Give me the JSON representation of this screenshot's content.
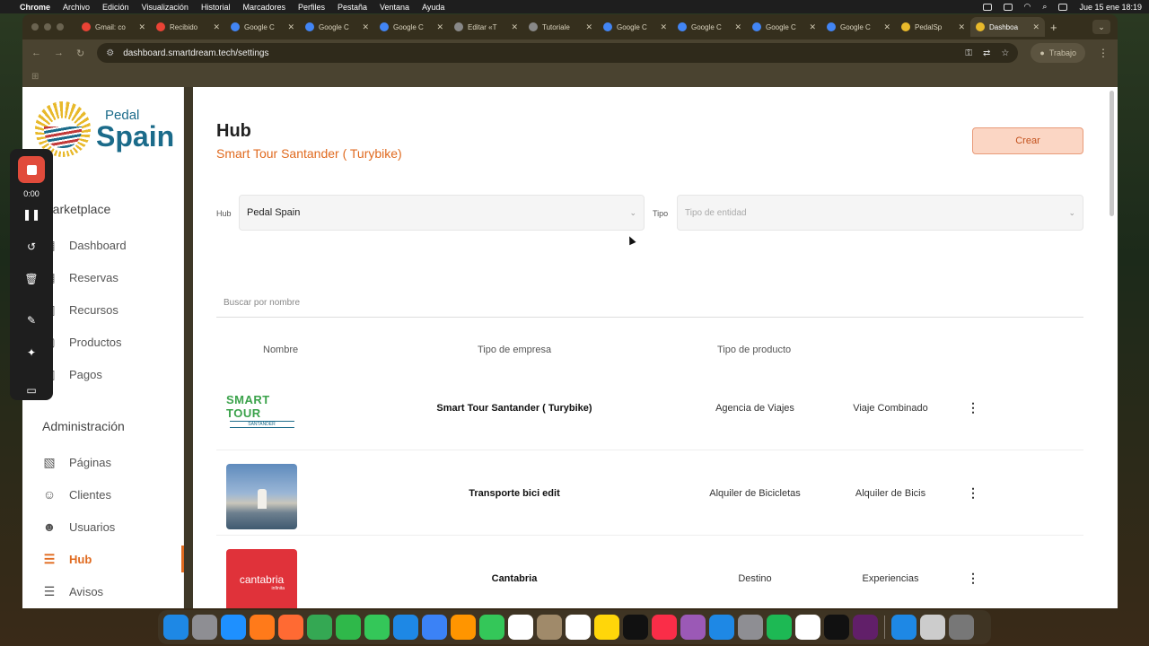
{
  "menubar": {
    "app": "Chrome",
    "items": [
      "Archivo",
      "Edición",
      "Visualización",
      "Historial",
      "Marcadores",
      "Perfiles",
      "Pestaña",
      "Ventana",
      "Ayuda"
    ],
    "clock": "Jue 15 ene 18:19"
  },
  "tabs": [
    {
      "label": "Gmail: co",
      "color": "#ea4335"
    },
    {
      "label": "Recibido",
      "color": "#ea4335"
    },
    {
      "label": "Google C",
      "color": "#4285f4"
    },
    {
      "label": "Google C",
      "color": "#4285f4"
    },
    {
      "label": "Google C",
      "color": "#4285f4"
    },
    {
      "label": "Editar «T",
      "color": "#888888"
    },
    {
      "label": "Tutoriale",
      "color": "#888888"
    },
    {
      "label": "Google C",
      "color": "#4285f4"
    },
    {
      "label": "Google C",
      "color": "#4285f4"
    },
    {
      "label": "Google C",
      "color": "#4285f4"
    },
    {
      "label": "Google C",
      "color": "#4285f4"
    },
    {
      "label": "PedalSp",
      "color": "#e8b92b"
    },
    {
      "label": "Dashboa",
      "color": "#e8b92b",
      "active": true
    }
  ],
  "toolbar": {
    "url": "dashboard.smartdream.tech/settings",
    "profile": "Trabajo"
  },
  "logo": {
    "line1": "Pedal",
    "line2": "Spain"
  },
  "recorder": {
    "time": "0:00"
  },
  "sidebar": {
    "marketplace_title": "Marketplace",
    "marketplace_items": [
      {
        "label": "Dashboard",
        "icon": "dashboard-icon"
      },
      {
        "label": "Reservas",
        "icon": "calendar-icon"
      },
      {
        "label": "Recursos",
        "icon": "resources-icon"
      },
      {
        "label": "Productos",
        "icon": "box-icon"
      },
      {
        "label": "Pagos",
        "icon": "payment-icon"
      }
    ],
    "admin_title": "Administración",
    "admin_items": [
      {
        "label": "Páginas",
        "icon": "page-icon"
      },
      {
        "label": "Clientes",
        "icon": "user-icon"
      },
      {
        "label": "Usuarios",
        "icon": "users-icon"
      },
      {
        "label": "Hub",
        "icon": "sliders-icon",
        "active": true
      },
      {
        "label": "Avisos",
        "icon": "sliders-icon"
      }
    ]
  },
  "main": {
    "title": "Hub",
    "subtitle": "Smart Tour Santander ( Turybike)",
    "create_label": "Crear",
    "hub_label": "Hub",
    "hub_value": "Pedal Spain",
    "tipo_label": "Tipo",
    "tipo_placeholder": "Tipo de entidad",
    "search_placeholder": "Buscar por nombre",
    "columns": [
      "Nombre",
      "Tipo de empresa",
      "Tipo de producto"
    ],
    "rows": [
      {
        "name": "Smart Tour Santander ( Turybike)",
        "company_type": "Agencia de Viajes",
        "product_type": "Viaje Combinado",
        "logo_text": "SMART TOUR",
        "logo_sub": "SANTANDER"
      },
      {
        "name": "Transporte bici edit",
        "company_type": "Alquiler de Bicicletas",
        "product_type": "Alquiler de Bicis"
      },
      {
        "name": "Cantabria",
        "company_type": "Destino",
        "product_type": "Experiencias",
        "logo_text": "cantabria",
        "logo_sub": "infinita"
      }
    ]
  },
  "dock_colors": [
    "#1e88e5",
    "#8e8e93",
    "#1e90ff",
    "#ff7a1a",
    "#ff6a33",
    "#34a853",
    "#2fb84a",
    "#34c759",
    "#1e88e5",
    "#3b82f6",
    "#ff9500",
    "#34c759",
    "#ffffff",
    "#a08a6a",
    "#ffffff",
    "#ffd60a",
    "#111111",
    "#fa2d48",
    "#9b59b6",
    "#1e88e5",
    "#8e8e93",
    "#1db954",
    "#ffffff",
    "#111111",
    "#611f69",
    "#1e88e5",
    "#cccccc",
    "#777777"
  ]
}
